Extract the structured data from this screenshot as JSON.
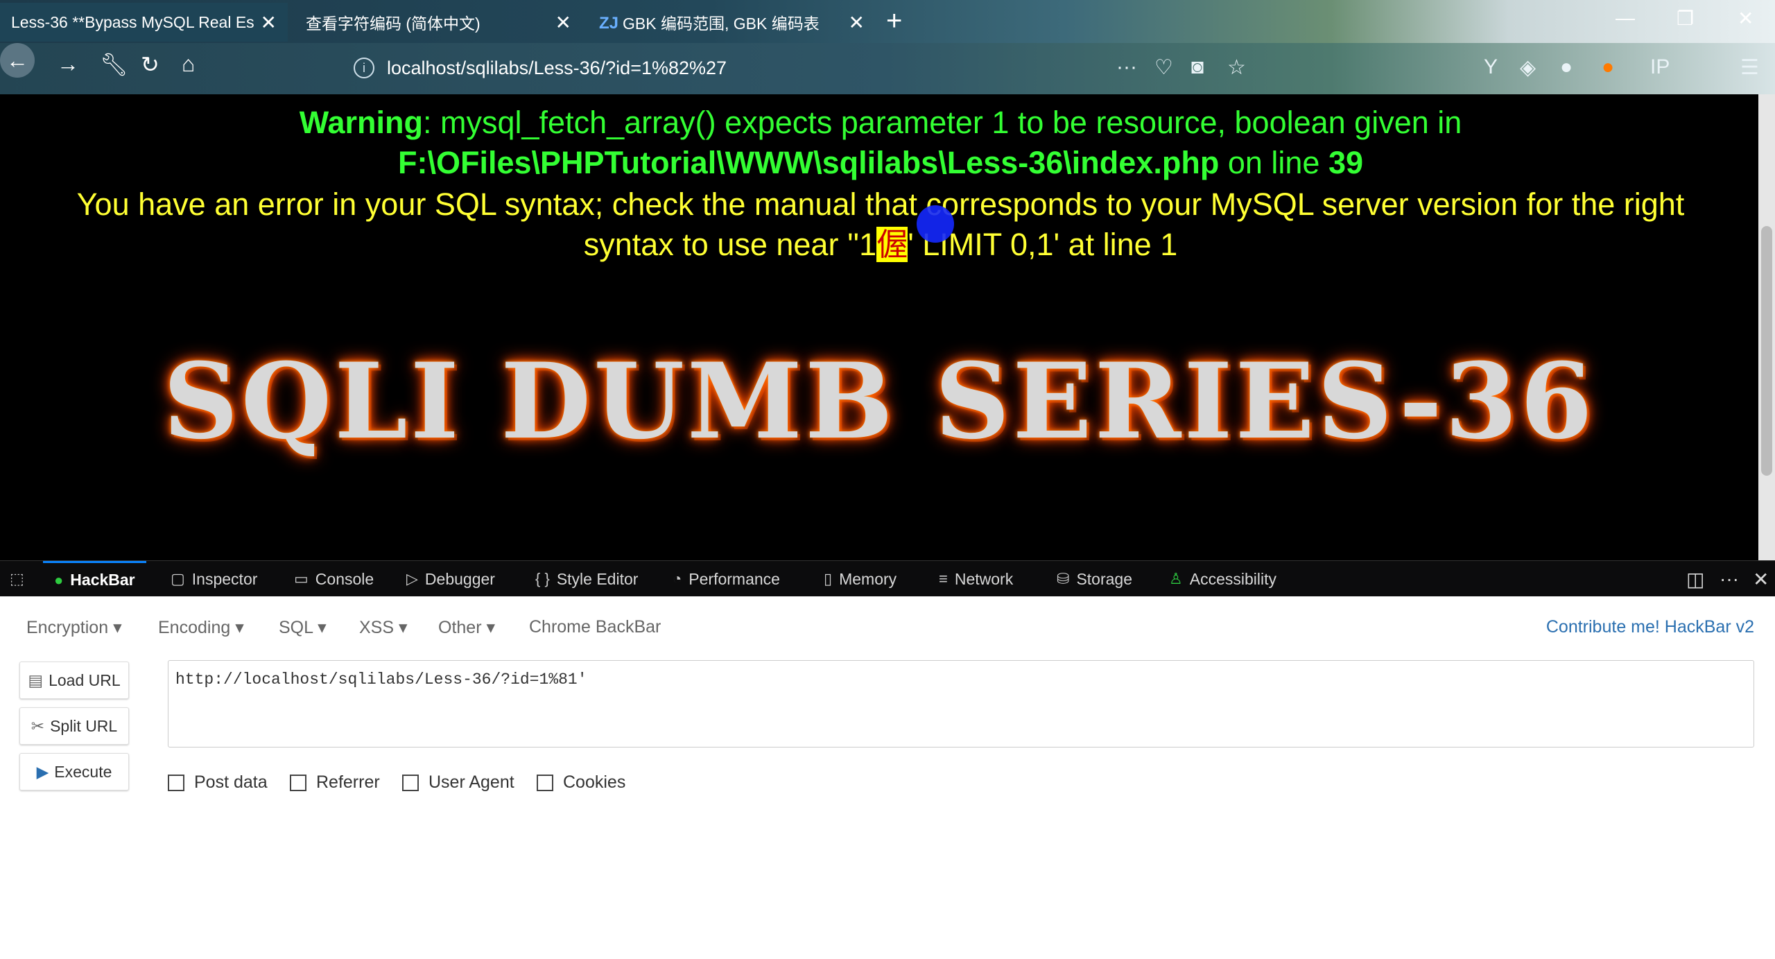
{
  "browser": {
    "tabs": [
      {
        "title": "Less-36 **Bypass MySQL Real Es"
      },
      {
        "title": "查看字符编码 (简体中文)"
      },
      {
        "title": "GBK 编码范围, GBK 编码表",
        "favicon": "ZJ"
      }
    ],
    "url": "localhost/sqlilabs/Less-36/?id=1%82%27"
  },
  "page": {
    "warning_label": "Warning",
    "warning_text": ": mysql_fetch_array() expects parameter 1 to be resource, boolean given in ",
    "warning_path": "F:\\OFiles\\PHPTutorial\\WWW\\sqlilabs\\Less-36\\index.php",
    "warning_online": " on line ",
    "warning_line": "39",
    "error_text_pre": "You have an error in your SQL syntax; check the manual that corresponds to your MySQL server version for the right syntax to use near ''1",
    "error_gbk_char": "偓",
    "error_text_post": "' LIMIT 0,1' at line 1",
    "banner": "SQLI DUMB SERIES-36"
  },
  "devtools": {
    "tabs": [
      "HackBar",
      "Inspector",
      "Console",
      "Debugger",
      "Style Editor",
      "Performance",
      "Memory",
      "Network",
      "Storage",
      "Accessibility"
    ]
  },
  "hackbar": {
    "menus": [
      "Encryption",
      "Encoding",
      "SQL",
      "XSS",
      "Other"
    ],
    "chrome_backbar": "Chrome BackBar",
    "contribute": "Contribute me! HackBar v2",
    "buttons": {
      "load": "Load URL",
      "split": "Split URL",
      "execute": "Execute"
    },
    "url_value": "http://localhost/sqlilabs/Less-36/?id=1%81'",
    "checkboxes": [
      "Post data",
      "Referrer",
      "User Agent",
      "Cookies"
    ]
  }
}
